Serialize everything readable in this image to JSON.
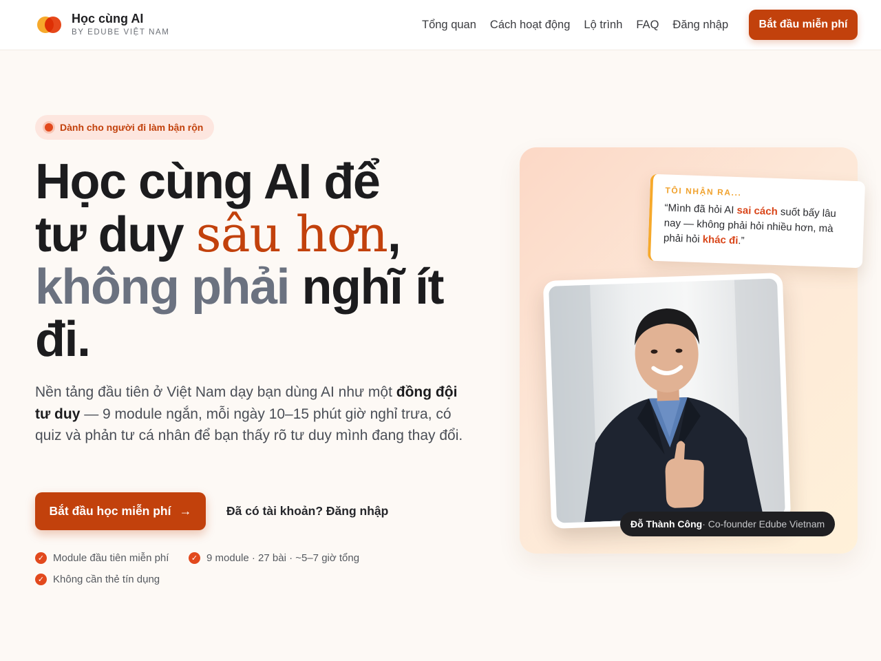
{
  "brand": {
    "title": "Học cùng AI",
    "subtitle": "BY EDUBE VIỆT NAM"
  },
  "nav": {
    "items": [
      "Tổng quan",
      "Cách hoạt động",
      "Lộ trình",
      "FAQ",
      "Đăng nhập"
    ],
    "cta": "Bắt đầu miễn phí"
  },
  "hero": {
    "badge": "Dành cho người đi làm bận rộn",
    "headline": {
      "line1": "Học cùng AI để",
      "line2_a": "tư duy ",
      "line2_b": "sâu hơn",
      "line2_c": ",",
      "line3_a": "không phải",
      "line3_b": " nghĩ ít",
      "line4": "đi."
    },
    "lead": {
      "part1": "Nền tảng đầu tiên ở Việt Nam dạy bạn dùng AI như một ",
      "bold": "đồng đội tư duy",
      "part2": " — 9 module ngắn, mỗi ngày 10–15 phút giờ nghỉ trưa, có quiz và phản tư cá nhân để bạn thấy rõ tư duy mình đang thay đổi."
    },
    "cta_primary": "Bắt đầu học miễn phí",
    "cta_arrow": "→",
    "cta_secondary": "Đã có tài khoản? Đăng nhập",
    "perks": [
      "Module đầu tiên miễn phí",
      "9 module · 27 bài · ~5–7 giờ tổng",
      "Không cần thẻ tín dụng"
    ]
  },
  "quote_card": {
    "label": "TÔI NHẬN RA...",
    "t1": "“Mình đã hỏi AI ",
    "h1": "sai cách",
    "t2": " suốt bấy lâu nay — không phải hỏi nhiều hơn, mà phải hỏi ",
    "h2": "khác đi",
    "t3": ".”"
  },
  "person": {
    "name": "Đỗ Thành Công",
    "role": " · Co-founder Edube Vietnam"
  },
  "colors": {
    "accent": "#c2410c",
    "accent_light": "#e2491d",
    "amber": "#f6a92b",
    "background": "#fdf9f5"
  }
}
